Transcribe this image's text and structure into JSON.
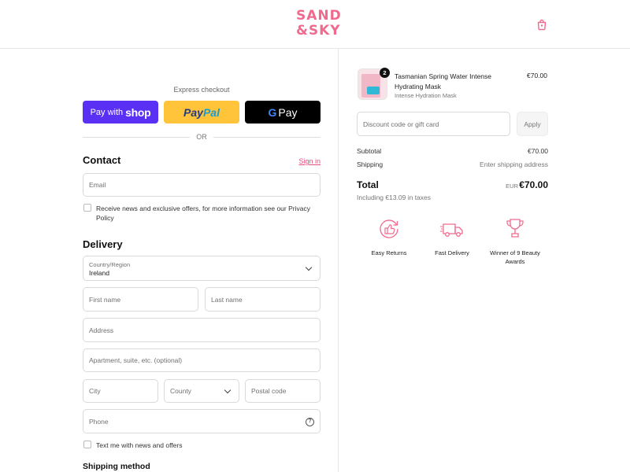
{
  "brand": {
    "line1": "SAND",
    "line2": "&SKY"
  },
  "colors": {
    "accent": "#f06a8e",
    "shop_pay": "#5a31f4",
    "paypal": "#ffc439",
    "gpay": "#000000"
  },
  "header": {
    "cart_icon": "shopping-bag-icon"
  },
  "express": {
    "label": "Express checkout",
    "shop_pay_prefix": "Pay with",
    "shop_pay_brand": "shop",
    "paypal_a": "Pay",
    "paypal_b": "Pal",
    "gpay_g": "G",
    "gpay_text": "Pay",
    "or": "OR"
  },
  "contact": {
    "title": "Contact",
    "sign_in": "Sign in",
    "email_placeholder": "Email",
    "news_offers": "Receive news and exclusive offers, for more information see our Privacy Policy"
  },
  "delivery": {
    "title": "Delivery",
    "country_label": "Country/Region",
    "country_value": "Ireland",
    "first_name": "First name",
    "last_name": "Last name",
    "address": "Address",
    "apartment": "Apartment, suite, etc. (optional)",
    "city": "City",
    "county": "County",
    "postal_code": "Postal code",
    "phone": "Phone",
    "text_me": "Text me with news and offers",
    "shipping_method": "Shipping method"
  },
  "order": {
    "item": {
      "name": "Tasmanian Spring Water Intense Hydrating Mask",
      "variant": "Intense Hydration Mask",
      "price": "€70.00",
      "quantity": "2"
    },
    "discount_placeholder": "Discount code or gift card",
    "apply": "Apply",
    "subtotal_label": "Subtotal",
    "subtotal_value": "€70.00",
    "shipping_label": "Shipping",
    "shipping_value": "Enter shipping address",
    "total_label": "Total",
    "currency": "EUR",
    "total_value": "€70.00",
    "tax_note": "Including €13.09 in taxes"
  },
  "features": [
    {
      "label": "Easy Returns",
      "icon": "return-thumbs-up-icon"
    },
    {
      "label": "Fast Delivery",
      "icon": "delivery-truck-icon"
    },
    {
      "label": "Winner of 9 Beauty Awards",
      "icon": "trophy-icon"
    }
  ]
}
